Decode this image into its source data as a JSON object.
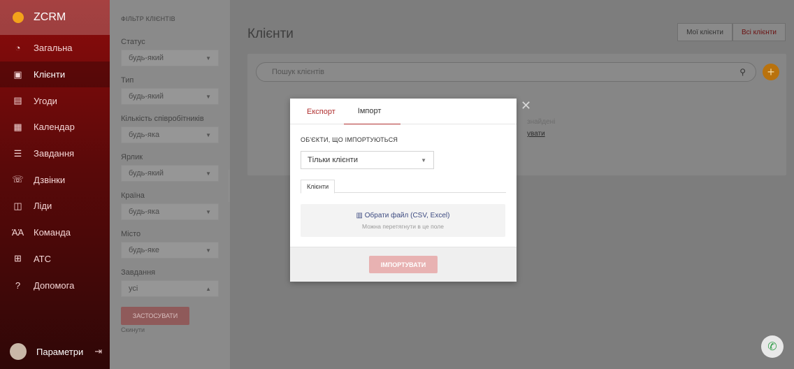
{
  "app": {
    "name": "ZCRM"
  },
  "sidebar": {
    "items": [
      {
        "label": "Загальна",
        "icon": "dashboard-icon"
      },
      {
        "label": "Клієнти",
        "icon": "clients-icon",
        "active": true
      },
      {
        "label": "Угоди",
        "icon": "deals-icon"
      },
      {
        "label": "Календар",
        "icon": "calendar-icon"
      },
      {
        "label": "Завдання",
        "icon": "tasks-icon"
      },
      {
        "label": "Дзвінки",
        "icon": "phone-icon"
      },
      {
        "label": "Ліди",
        "icon": "leads-icon"
      },
      {
        "label": "Команда",
        "icon": "team-icon"
      },
      {
        "label": "АТС",
        "icon": "pbx-icon"
      },
      {
        "label": "Допомога",
        "icon": "help-icon"
      }
    ],
    "settings_label": "Параметри"
  },
  "filters": {
    "title": "ФІЛЬТР КЛІЄНТІВ",
    "groups": [
      {
        "label": "Статус",
        "value": "будь-який"
      },
      {
        "label": "Тип",
        "value": "будь-який"
      },
      {
        "label": "Кількість співробітників",
        "value": "будь-яка"
      },
      {
        "label": "Ярлик",
        "value": "будь-який"
      },
      {
        "label": "Країна",
        "value": "будь-яка"
      },
      {
        "label": "Місто",
        "value": "будь-яке"
      },
      {
        "label": "Завдання",
        "value": "усі"
      }
    ],
    "apply_label": "ЗАСТОСУВАТИ",
    "reset_label": "Скинути"
  },
  "main": {
    "title": "Клієнти",
    "toggle": {
      "mine": "Мої клієнти",
      "all": "Всі клієнти"
    },
    "search": {
      "placeholder": "Пошук клієнтів"
    },
    "empty_text": "знайдені",
    "empty_link": "увати"
  },
  "modal": {
    "tabs": {
      "export": "Експорт",
      "import": "Імпорт"
    },
    "section_label": "ОБ'ЄКТИ, ЩО ІМПОРТУЮТЬСЯ",
    "object_select": "Тільки клієнти",
    "subtab": "Клієнти",
    "drop": {
      "pick": "Обрати файл (CSV, Excel)",
      "hint": "Можна перетягнути в це поле"
    },
    "import_button": "ІМПОРТУВАТИ"
  },
  "colors": {
    "accent": "#b03030",
    "add_button": "#f5a623",
    "phone": "#2e9d46"
  }
}
